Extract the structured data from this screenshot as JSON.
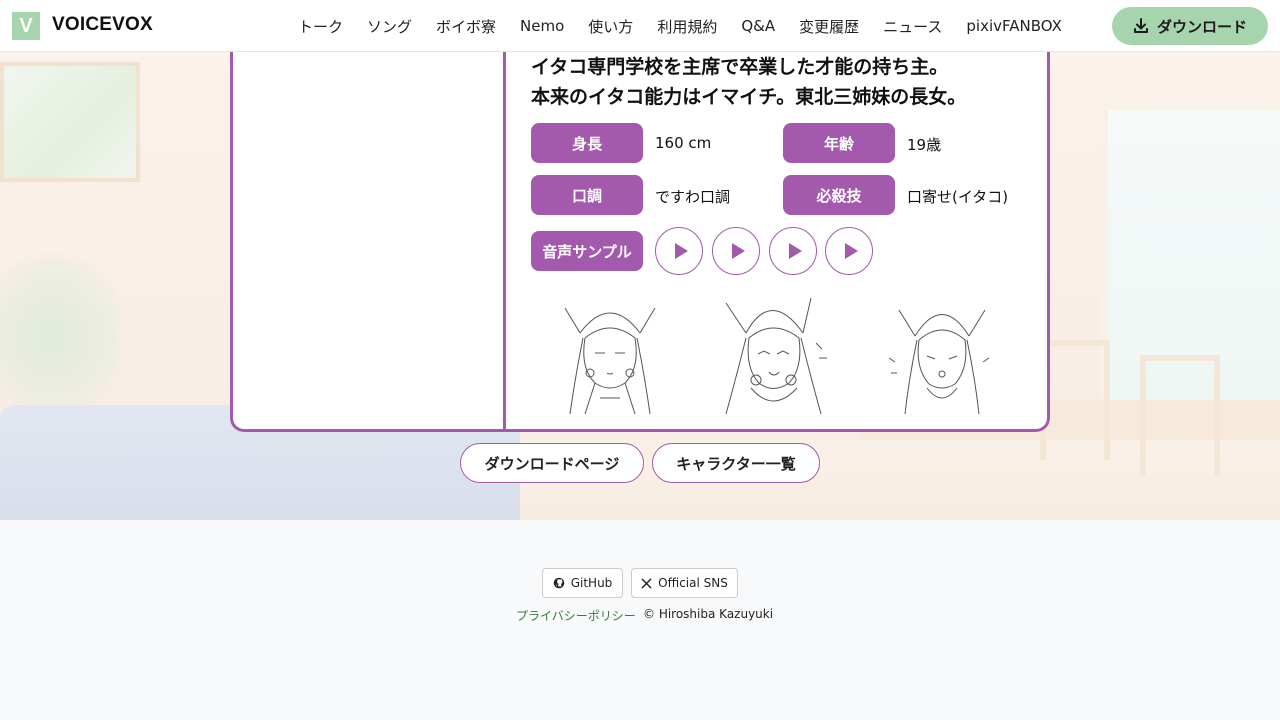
{
  "header": {
    "logo_letter": "V",
    "logo_text": "VOICEVOX",
    "nav": [
      "トーク",
      "ソング",
      "ボイボ寮",
      "Nemo",
      "使い方",
      "利用規約",
      "Q&A",
      "変更履歴",
      "ニュース",
      "pixivFANBOX"
    ],
    "download_label": "ダウンロード",
    "download_icon": "download-icon",
    "accent_color": "#a5d4ad"
  },
  "character": {
    "description": [
      "イタコ専門学校を主席で卒業した才能の持ち主。",
      "本来のイタコ能力はイマイチ。東北三姉妹の長女。"
    ],
    "theme_color": "#a35aad",
    "profile": [
      {
        "label": "身長",
        "value": "160 cm"
      },
      {
        "label": "年齢",
        "value": "19歳"
      },
      {
        "label": "口調",
        "value": "ですわ口調"
      },
      {
        "label": "必殺技",
        "value": "口寄せ(イタコ)"
      }
    ],
    "voice_sample_label": "音声サンプル",
    "voice_sample_count": 4,
    "play_icon": "play-icon"
  },
  "links": {
    "download_page": "ダウンロードページ",
    "character_list": "キャラクター一覧"
  },
  "footer": {
    "github": "GitHub",
    "sns": "Official SNS",
    "privacy": "プライバシーポリシー",
    "copyright": "© Hiroshiba Kazuyuki"
  }
}
